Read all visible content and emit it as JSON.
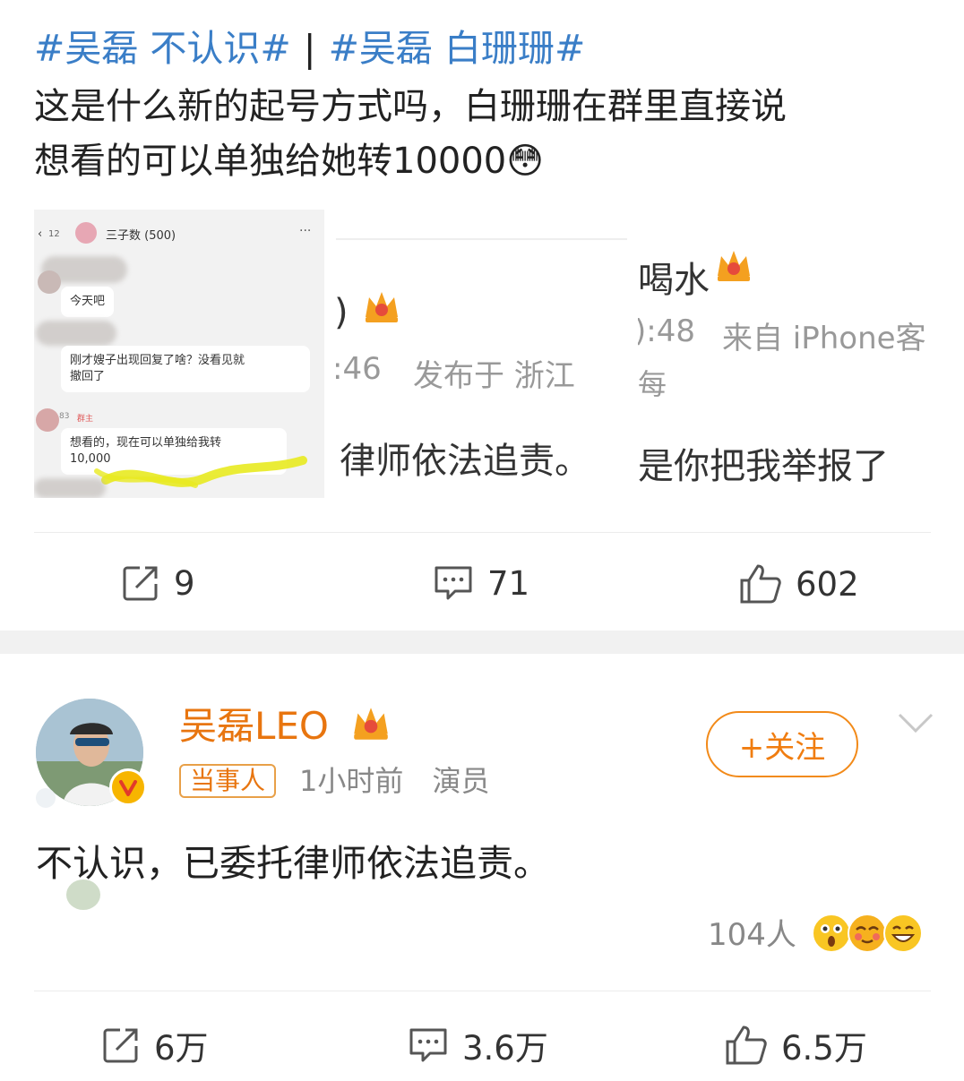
{
  "post": {
    "topic1": "#吴磊 不认识#",
    "separator": "|",
    "topic2": "#吴磊 白珊珊#",
    "line1": "这是什么新的起号方式吗，白珊珊在群里直接说",
    "line2": "想看的可以单独给她转10000",
    "line2_emoji": "😳",
    "chat_shot": {
      "badge": "12",
      "group": "三子数 (500)",
      "more": "···",
      "msg1": "今天吧",
      "msg2a": "刚才嫂子出现回复了啥？没看见就",
      "msg2b": "撤回了",
      "tag": "83",
      "role": "群主",
      "msg3a": "想看的，现在可以单独给我转",
      "msg3b": "10,000"
    },
    "shot2": {
      "name_tail": ")",
      "time": ":46",
      "location": "发布于 浙江",
      "text": "律师依法追责。"
    },
    "shot3": {
      "name_tail": "喝水",
      "time": "):48",
      "source": "来自 iPhone客",
      "extra": "每",
      "text": "是你把我举报了"
    },
    "actions": {
      "repost": "9",
      "comment": "71",
      "like": "602"
    }
  },
  "reply_post": {
    "username": "吴磊LEO",
    "badge": "当事人",
    "time": "1小时前",
    "role": "演员",
    "follow": "+关注",
    "text": "不认识，已委托律师依法追责。",
    "reaction_count": "104人",
    "actions": {
      "repost": "6万",
      "comment": "3.6万",
      "like": "6.5万"
    }
  },
  "colors": {
    "topic": "#3a7ec7",
    "username": "#e8750f",
    "follow": "#f07d10"
  }
}
